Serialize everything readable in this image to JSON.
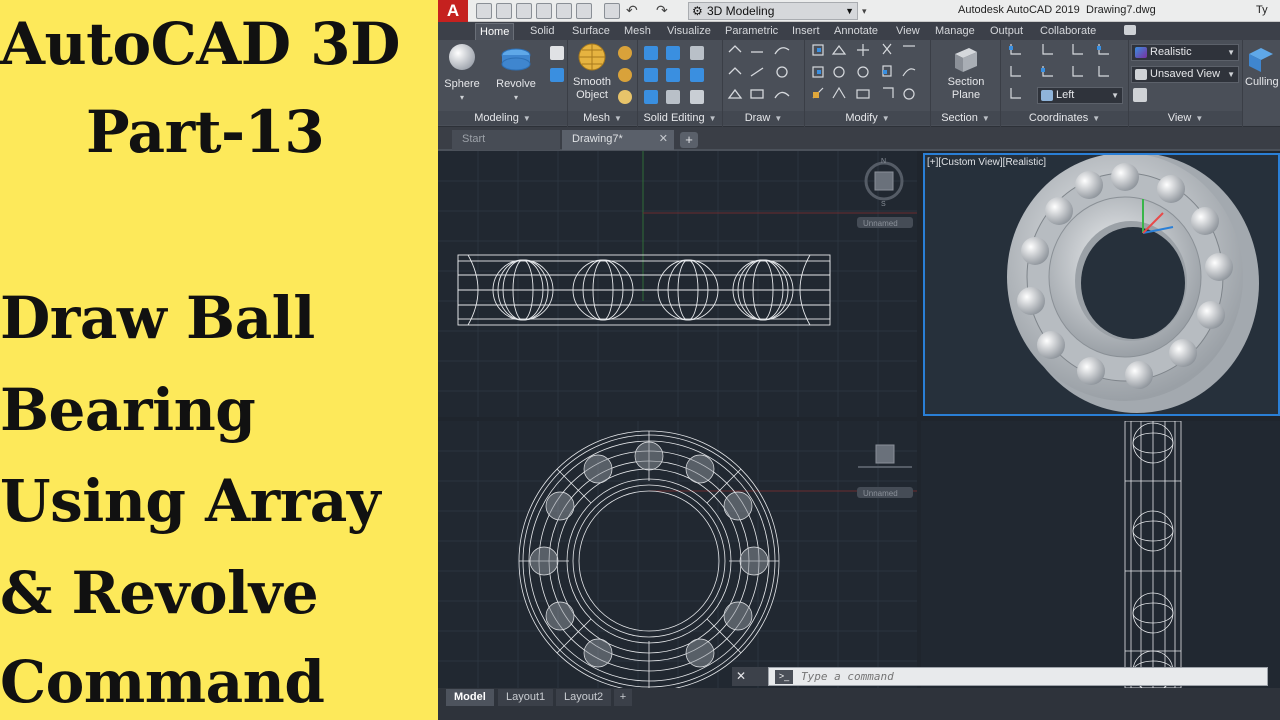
{
  "overlay_title": {
    "line1": "AutoCAD 3D",
    "line2": "Part-13",
    "line3": "Draw Ball",
    "line4": "Bearing",
    "line5": "Using Array",
    "line6": "& Revolve",
    "line7": "Command"
  },
  "titlebar": {
    "logo": "A",
    "workspace": "3D Modeling",
    "app_title": "Autodesk AutoCAD 2019",
    "document": "Drawing7.dwg",
    "type_hint": "Ty"
  },
  "ribbon_tabs": [
    "Home",
    "Solid",
    "Surface",
    "Mesh",
    "Visualize",
    "Parametric",
    "Insert",
    "Annotate",
    "View",
    "Manage",
    "Output",
    "Collaborate"
  ],
  "ribbon": {
    "sphere_label": "Sphere",
    "revolve_label": "Revolve",
    "smooth_label1": "Smooth",
    "smooth_label2": "Object",
    "section_label1": "Section",
    "section_label2": "Plane",
    "visual_style": "Realistic",
    "saved_view": "Unsaved View",
    "ucs_view": "Left",
    "culling_label": "Culling",
    "panels": {
      "modeling": "Modeling",
      "mesh": "Mesh",
      "solid_editing": "Solid Editing",
      "draw": "Draw",
      "modify": "Modify",
      "section": "Section",
      "coordinates": "Coordinates",
      "view": "View"
    },
    "accent_color": "#3a8fe0"
  },
  "file_tabs": {
    "start": "Start",
    "drawing": "Drawing7*",
    "plus": "+"
  },
  "viewports": {
    "vp2_label": "[+][Custom View][Realistic]",
    "unnamed": "Unnamed",
    "active_border_color": "#2a7fd6"
  },
  "command_line": {
    "placeholder": "Type a command",
    "prompt_icon": ">_"
  },
  "layout_tabs": [
    "Model",
    "Layout1",
    "Layout2"
  ],
  "layout_plus": "+"
}
